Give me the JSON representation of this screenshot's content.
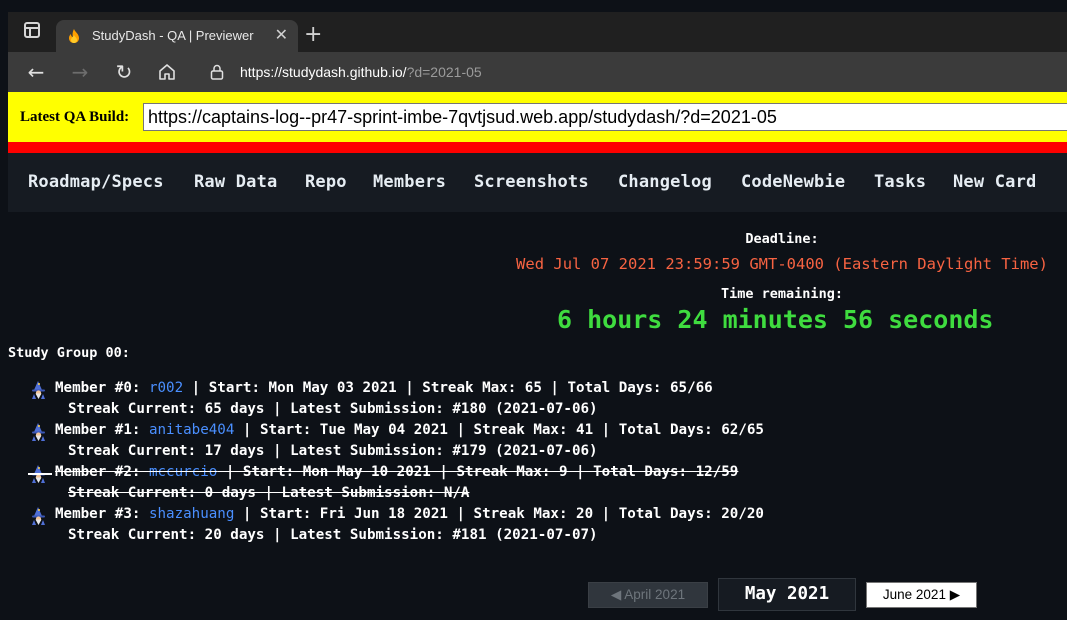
{
  "browser": {
    "tab_title": "StudyDash - QA | Previewer",
    "url_main": "https://studydash.github.io/",
    "url_query": "?d=2021-05"
  },
  "qa_banner": {
    "label": "Latest QA Build:",
    "value": "https://captains-log--pr47-sprint-imbe-7qvtjsud.web.app/studydash/?d=2021-05"
  },
  "nav": {
    "items": [
      "Roadmap/Specs",
      "Raw Data",
      "Repo",
      "Members",
      "Screenshots",
      "Changelog",
      "CodeNewbie",
      "Tasks",
      "New Card"
    ]
  },
  "deadline": {
    "label": "Deadline:",
    "value": "Wed Jul 07 2021 23:59:59 GMT-0400 (Eastern Daylight Time)",
    "remaining_label": "Time remaining:",
    "remaining_value": "6 hours 24 minutes 56 seconds"
  },
  "group": {
    "title": "Study Group 00:",
    "members": [
      {
        "prefix": "Member #0: ",
        "username": "r002",
        "line1_rest": " | Start: Mon May 03 2021 | Streak Max: 65 | Total Days: 65/66",
        "line2": "Streak Current: 65 days | Latest Submission: #180 (2021-07-06)"
      },
      {
        "prefix": "Member #1: ",
        "username": "anitabe404",
        "line1_rest": " | Start: Tue May 04 2021 | Streak Max: 41 | Total Days: 62/65",
        "line2": "Streak Current: 17 days | Latest Submission: #179 (2021-07-06)"
      },
      {
        "prefix": "Member #2: ",
        "username": "mccurcio",
        "line1_rest": " | Start: Mon May 10 2021 | Streak Max: 9 | Total Days: 12/59",
        "line2": "Streak Current: 0 days | Latest Submission: N/A"
      },
      {
        "prefix": "Member #3: ",
        "username": "shazahuang",
        "line1_rest": " | Start: Fri Jun 18 2021 | Streak Max: 20 | Total Days: 20/20",
        "line2": "Streak Current: 20 days | Latest Submission: #181 (2021-07-07)"
      }
    ]
  },
  "pager": {
    "prev": "◀ April 2021",
    "current": "May 2021",
    "next": "June 2021 ▶"
  }
}
